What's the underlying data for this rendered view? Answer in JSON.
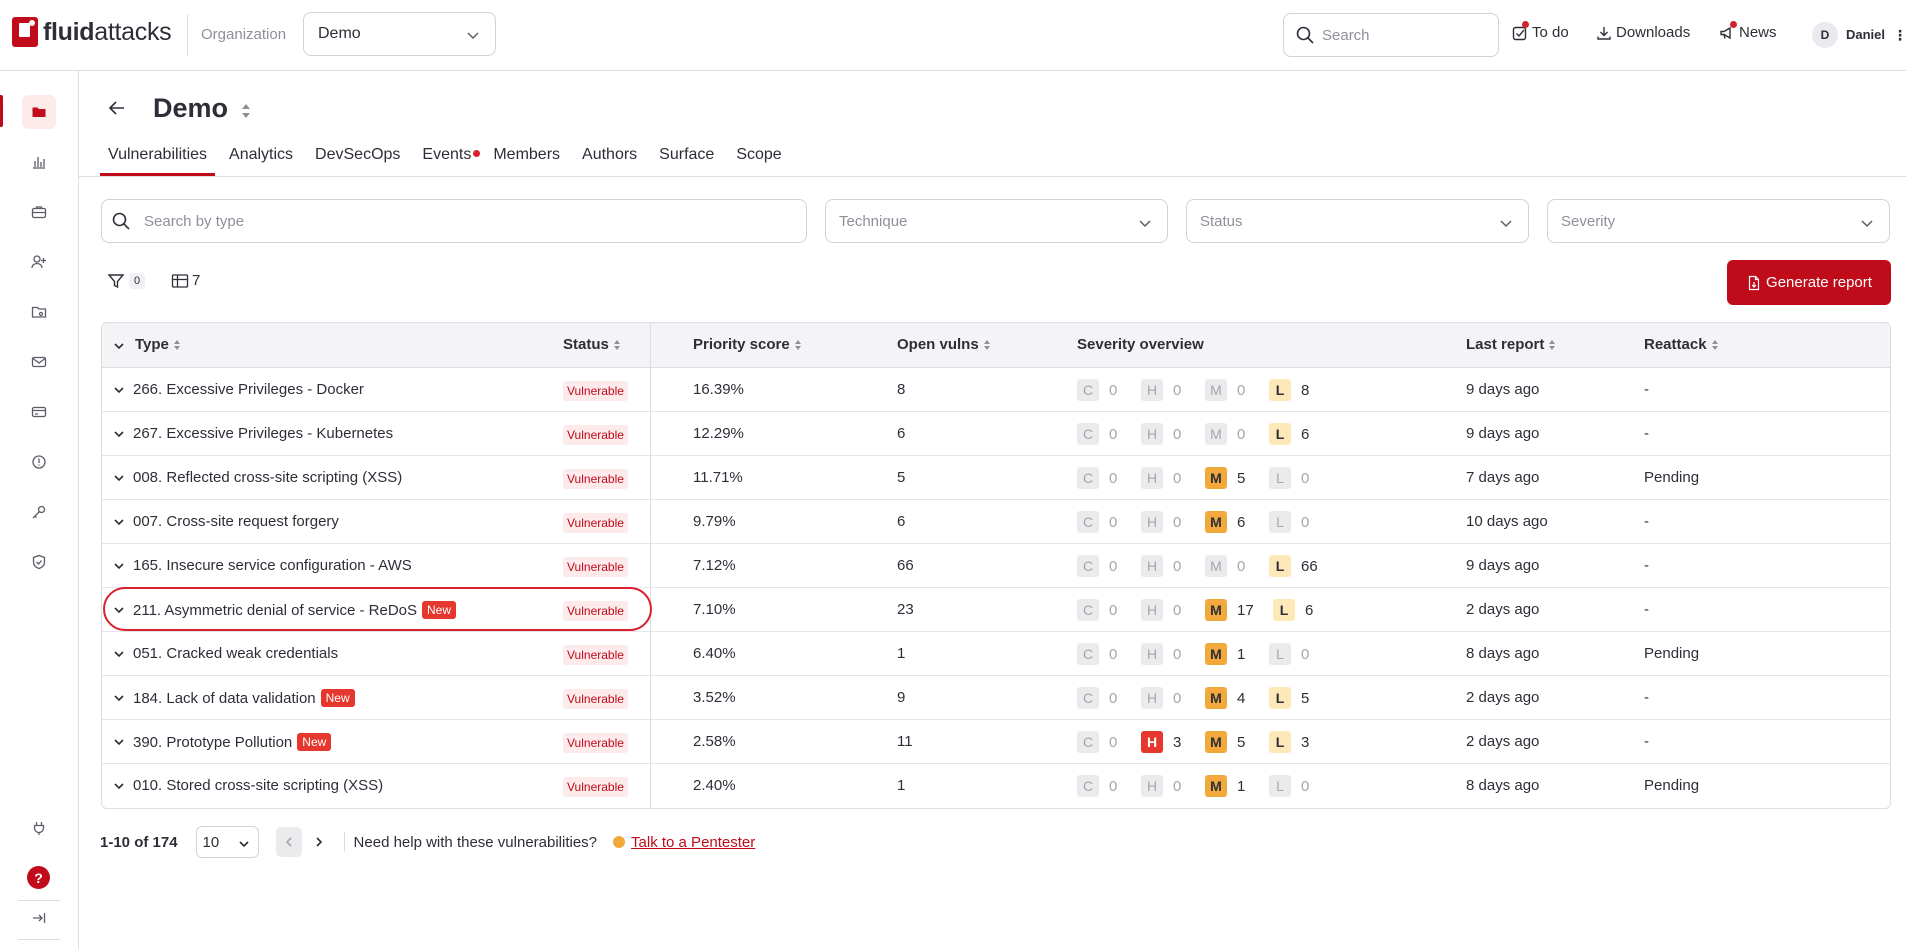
{
  "brand": {
    "name_bold": "fluid",
    "name_rest": "attacks"
  },
  "header": {
    "org_label": "Organization",
    "org_value": "Demo",
    "search_placeholder": "Search",
    "todo": "To do",
    "downloads": "Downloads",
    "news": "News",
    "avatar_initial": "D",
    "user_name": "Daniel"
  },
  "sidebar": {
    "items": [
      "folder-icon",
      "chart-icon",
      "briefcase-icon",
      "user-add-icon",
      "folder-key-icon",
      "mail-icon",
      "card-icon",
      "alert-icon",
      "key-icon",
      "shield-icon"
    ],
    "help": "?"
  },
  "page": {
    "title": "Demo",
    "tabs": [
      "Vulnerabilities",
      "Analytics",
      "DevSecOps",
      "Events",
      "Members",
      "Authors",
      "Surface",
      "Scope"
    ],
    "active_tab": "Vulnerabilities"
  },
  "filters": {
    "search_placeholder": "Search by type",
    "technique": "Technique",
    "status": "Status",
    "severity": "Severity",
    "filter_count": "0",
    "columns_count": "7",
    "generate_report": "Generate report"
  },
  "table": {
    "headers": {
      "type": "Type",
      "status": "Status",
      "priority": "Priority score",
      "open": "Open vulns",
      "severity": "Severity overview",
      "last": "Last report",
      "reattack": "Reattack"
    },
    "rows": [
      {
        "type": "266. Excessive Privileges - Docker",
        "new": "",
        "status": "Vulnerable",
        "priority": "16.39%",
        "open": "8",
        "sev": {
          "C": "0",
          "H": "0",
          "M": "0",
          "L": "8"
        },
        "last": "9 days ago",
        "reattack": "-"
      },
      {
        "type": "267. Excessive Privileges - Kubernetes",
        "new": "",
        "status": "Vulnerable",
        "priority": "12.29%",
        "open": "6",
        "sev": {
          "C": "0",
          "H": "0",
          "M": "0",
          "L": "6"
        },
        "last": "9 days ago",
        "reattack": "-"
      },
      {
        "type": "008. Reflected cross-site scripting (XSS)",
        "new": "",
        "status": "Vulnerable",
        "priority": "11.71%",
        "open": "5",
        "sev": {
          "C": "0",
          "H": "0",
          "M": "5",
          "L": "0"
        },
        "last": "7 days ago",
        "reattack": "Pending"
      },
      {
        "type": "007. Cross-site request forgery",
        "new": "",
        "status": "Vulnerable",
        "priority": "9.79%",
        "open": "6",
        "sev": {
          "C": "0",
          "H": "0",
          "M": "6",
          "L": "0"
        },
        "last": "10 days ago",
        "reattack": "-"
      },
      {
        "type": "165. Insecure service configuration - AWS",
        "new": "",
        "status": "Vulnerable",
        "priority": "7.12%",
        "open": "66",
        "sev": {
          "C": "0",
          "H": "0",
          "M": "0",
          "L": "66"
        },
        "last": "9 days ago",
        "reattack": "-"
      },
      {
        "type": "211. Asymmetric denial of service - ReDoS",
        "new": "New",
        "status": "Vulnerable",
        "priority": "7.10%",
        "open": "23",
        "sev": {
          "C": "0",
          "H": "0",
          "M": "17",
          "L": "6"
        },
        "last": "2 days ago",
        "reattack": "-"
      },
      {
        "type": "051. Cracked weak credentials",
        "new": "",
        "status": "Vulnerable",
        "priority": "6.40%",
        "open": "1",
        "sev": {
          "C": "0",
          "H": "0",
          "M": "1",
          "L": "0"
        },
        "last": "8 days ago",
        "reattack": "Pending"
      },
      {
        "type": "184. Lack of data validation",
        "new": "New",
        "status": "Vulnerable",
        "priority": "3.52%",
        "open": "9",
        "sev": {
          "C": "0",
          "H": "0",
          "M": "4",
          "L": "5"
        },
        "last": "2 days ago",
        "reattack": "-"
      },
      {
        "type": "390. Prototype Pollution",
        "new": "New",
        "status": "Vulnerable",
        "priority": "2.58%",
        "open": "11",
        "sev": {
          "C": "0",
          "H": "3",
          "M": "5",
          "L": "3"
        },
        "last": "2 days ago",
        "reattack": "-"
      },
      {
        "type": "010. Stored cross-site scripting (XSS)",
        "new": "",
        "status": "Vulnerable",
        "priority": "2.40%",
        "open": "1",
        "sev": {
          "C": "0",
          "H": "0",
          "M": "1",
          "L": "0"
        },
        "last": "8 days ago",
        "reattack": "Pending"
      }
    ]
  },
  "pagination": {
    "range": "1-10 of 174",
    "page_size": "10",
    "help_text": "Need help with these vulnerabilities?",
    "talk_link": "Talk to a Pentester"
  },
  "colors": {
    "brand": "#bf0b1a",
    "critical": "#7d0d15",
    "high": "#e5372e",
    "medium": "#f2a93b",
    "low": "#fde9b8"
  }
}
